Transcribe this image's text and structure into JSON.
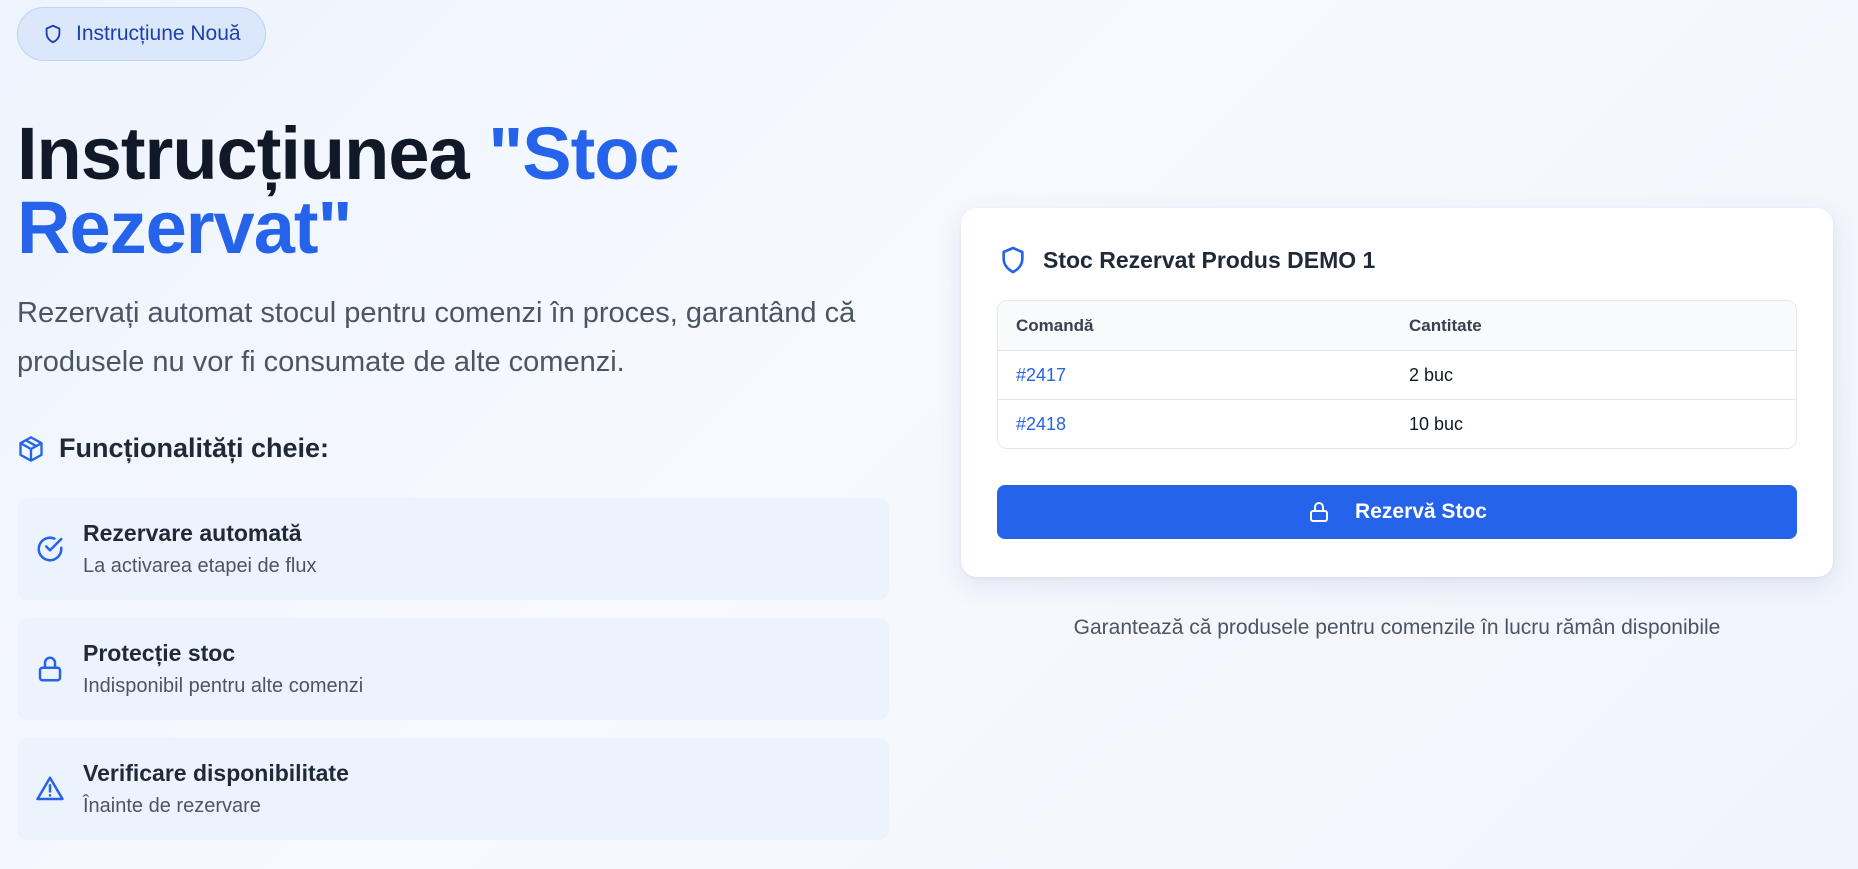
{
  "badge": {
    "label": "Instrucțiune Nouă",
    "icon": "shield-icon"
  },
  "hero": {
    "title_main": "Instrucțiunea ",
    "title_accent": "\"Stoc Rezervat\"",
    "description": "Rezervați automat stocul pentru comenzi în proces, garantând că produsele nu vor fi consumate de alte comenzi."
  },
  "features": {
    "heading": "Funcționalități cheie:",
    "heading_icon": "package-icon",
    "items": [
      {
        "title": "Rezervare automată",
        "desc": "La activarea etapei de flux",
        "icon": "check-circle-icon"
      },
      {
        "title": "Protecție stoc",
        "desc": "Indisponibil pentru alte comenzi",
        "icon": "lock-icon"
      },
      {
        "title": "Verificare disponibilitate",
        "desc": "Înainte de rezervare",
        "icon": "alert-triangle-icon"
      }
    ]
  },
  "card": {
    "title": "Stoc Rezervat Produs DEMO 1",
    "icon": "shield-icon",
    "table": {
      "headers": [
        "Comandă",
        "Cantitate"
      ],
      "rows": [
        [
          "#2417",
          "2 buc"
        ],
        [
          "#2418",
          "10 buc"
        ]
      ]
    },
    "button_label": "Rezervă Stoc",
    "button_icon": "lock-icon"
  },
  "footnote": "Garantează că produsele pentru comenzile în lucru rămân disponibile",
  "colors": {
    "accent": "#2563eb",
    "text": "#111827",
    "muted": "#4b5563"
  }
}
